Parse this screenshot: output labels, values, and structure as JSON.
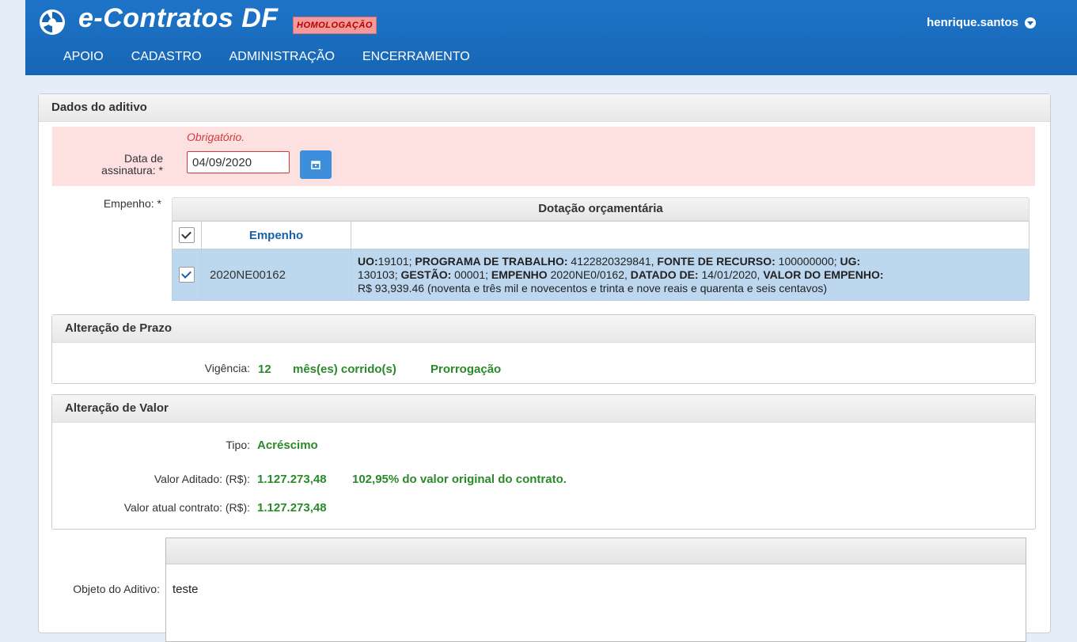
{
  "app": {
    "title": "e-Contratos DF",
    "env_badge": "HOMOLOGAÇÃO",
    "user": "henrique.santos"
  },
  "nav": [
    "APOIO",
    "CADASTRO",
    "ADMINISTRAÇÃO",
    "ENCERRAMENTO"
  ],
  "card": {
    "title": "Dados do aditivo"
  },
  "date_field": {
    "error": "Obrigatório.",
    "label_line1": "Data de",
    "label_line2": "assinatura: *",
    "value": "04/09/2020"
  },
  "empenho": {
    "label": "Empenho: *",
    "table_title": "Dotação orçamentária",
    "col_empenho": "Empenho",
    "row": {
      "code": "2020NE00162",
      "line1_a": "UO:",
      "line1_b": "19101; ",
      "line1_c": "PROGRAMA DE TRABALHO: ",
      "line1_d": "4122820329841, ",
      "line1_e": "FONTE DE RECURSO: ",
      "line1_f": "100000000; ",
      "line1_g": "UG:",
      "line2_a": "130103; ",
      "line2_b": "GESTÃO: ",
      "line2_c": "00001; ",
      "line2_d": "EMPENHO ",
      "line2_e": "2020NE0/0162, ",
      "line2_f": "DATADO DE: ",
      "line2_g": "14/01/2020, ",
      "line2_h": "VALOR DO EMPENHO:",
      "line3": "R$ 93,939.46 (noventa e três mil e novecentos e trinta e nove reais e quarenta e seis centavos)"
    }
  },
  "prazo": {
    "title": "Alteração de Prazo",
    "vigencia_label": "Vigência:",
    "vigencia_value": "12",
    "vigencia_unit": "mês(es) corrido(s)",
    "vigencia_type": "Prorrogação"
  },
  "valor": {
    "title": "Alteração de Valor",
    "tipo_label": "Tipo:",
    "tipo_value": "Acréscimo",
    "aditado_label": "Valor Aditado: (R$):",
    "aditado_value": "1.127.273,48",
    "aditado_pct": "102,95% do valor original do contrato.",
    "atual_label": "Valor atual contrato: (R$):",
    "atual_value": "1.127.273,48"
  },
  "objeto": {
    "label": "Objeto do Aditivo:",
    "value": "teste"
  },
  "colors": {
    "header_blue": "#1766b5",
    "error_bg": "#fde0e0",
    "value_green": "#2a8a2a",
    "selected_row": "#bdd7ee"
  }
}
